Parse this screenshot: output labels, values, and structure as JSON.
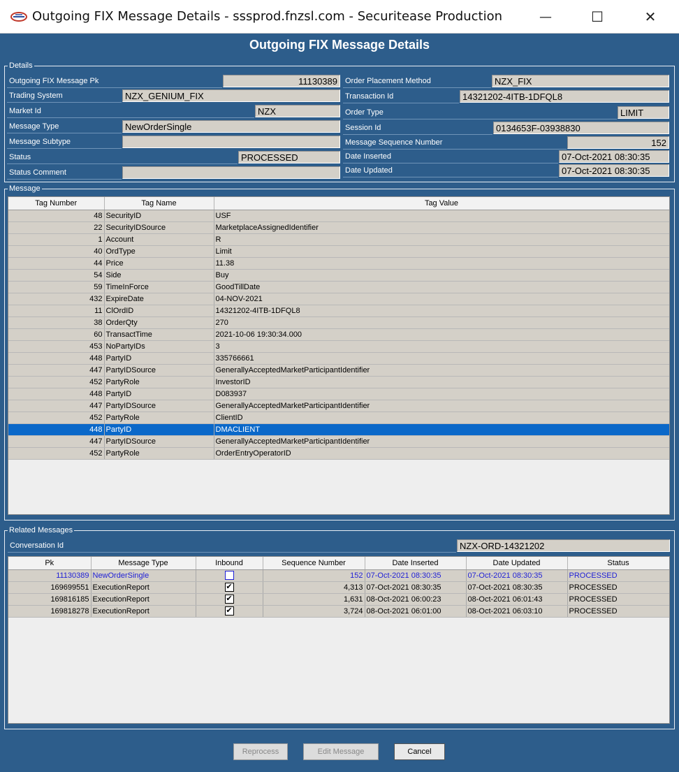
{
  "window": {
    "title": "Outgoing FIX Message Details - sssprod.fnzsl.com - Securitease Production",
    "min_glyph": "—",
    "max_glyph": "☐",
    "close_glyph": "✕"
  },
  "banner": "Outgoing FIX Message Details",
  "details": {
    "legend": "Details",
    "left": [
      {
        "label": "Outgoing FIX Message Pk",
        "value": "11130389"
      },
      {
        "label": "Trading System",
        "value": "NZX_GENIUM_FIX"
      },
      {
        "label": "Market Id",
        "value": "NZX"
      },
      {
        "label": "Message Type",
        "value": "NewOrderSingle"
      },
      {
        "label": "Message Subtype",
        "value": ""
      },
      {
        "label": "Status",
        "value": "PROCESSED"
      },
      {
        "label": "Status Comment",
        "value": ""
      }
    ],
    "right": [
      {
        "label": "Order Placement Method",
        "value": "NZX_FIX"
      },
      {
        "label": "Transaction Id",
        "value": "14321202-4ITB-1DFQL8"
      },
      {
        "label": "Order Type",
        "value": "LIMIT"
      },
      {
        "label": "Session Id",
        "value": "0134653F-03938830"
      },
      {
        "label": "Message Sequence Number",
        "value": "152"
      },
      {
        "label": "Date Inserted",
        "value": "07-Oct-2021 08:30:35"
      },
      {
        "label": "Date Updated",
        "value": "07-Oct-2021 08:30:35"
      }
    ]
  },
  "message": {
    "legend": "Message",
    "columns": [
      "Tag Number",
      "Tag Name",
      "Tag Value"
    ],
    "selected_index": 18,
    "rows": [
      [
        "48",
        "SecurityID",
        "USF"
      ],
      [
        "22",
        "SecurityIDSource",
        "MarketplaceAssignedIdentifier"
      ],
      [
        "1",
        "Account",
        "R"
      ],
      [
        "40",
        "OrdType",
        "Limit"
      ],
      [
        "44",
        "Price",
        "11.38"
      ],
      [
        "54",
        "Side",
        "Buy"
      ],
      [
        "59",
        "TimeInForce",
        "GoodTillDate"
      ],
      [
        "432",
        "ExpireDate",
        "04-NOV-2021"
      ],
      [
        "11",
        "ClOrdID",
        "14321202-4ITB-1DFQL8"
      ],
      [
        "38",
        "OrderQty",
        "270"
      ],
      [
        "60",
        "TransactTime",
        "2021-10-06 19:30:34.000"
      ],
      [
        "453",
        "NoPartyIDs",
        "3"
      ],
      [
        "448",
        "PartyID",
        "335766661"
      ],
      [
        "447",
        "PartyIDSource",
        "GenerallyAcceptedMarketParticipantIdentifier"
      ],
      [
        "452",
        "PartyRole",
        "InvestorID"
      ],
      [
        "448",
        "PartyID",
        "D083937"
      ],
      [
        "447",
        "PartyIDSource",
        "GenerallyAcceptedMarketParticipantIdentifier"
      ],
      [
        "452",
        "PartyRole",
        "ClientID"
      ],
      [
        "448",
        "PartyID",
        "DMACLIENT"
      ],
      [
        "447",
        "PartyIDSource",
        "GenerallyAcceptedMarketParticipantIdentifier"
      ],
      [
        "452",
        "PartyRole",
        "OrderEntryOperatorID"
      ]
    ]
  },
  "related": {
    "legend": "Related Messages",
    "conversation_label": "Conversation Id",
    "conversation_value": "NZX-ORD-14321202",
    "columns": [
      "Pk",
      "Message Type",
      "Inbound",
      "Sequence Number",
      "Date Inserted",
      "Date Updated",
      "Status"
    ],
    "rows": [
      {
        "pk": "11130389",
        "type": "NewOrderSingle",
        "inbound": false,
        "seq": "152",
        "inserted": "07-Oct-2021 08:30:35",
        "updated": "07-Oct-2021 08:30:35",
        "status": "PROCESSED",
        "current": true
      },
      {
        "pk": "169699551",
        "type": "ExecutionReport",
        "inbound": true,
        "seq": "4,313",
        "inserted": "07-Oct-2021 08:30:35",
        "updated": "07-Oct-2021 08:30:35",
        "status": "PROCESSED",
        "current": false
      },
      {
        "pk": "169816185",
        "type": "ExecutionReport",
        "inbound": true,
        "seq": "1,631",
        "inserted": "08-Oct-2021 06:00:23",
        "updated": "08-Oct-2021 06:01:43",
        "status": "PROCESSED",
        "current": false
      },
      {
        "pk": "169818278",
        "type": "ExecutionReport",
        "inbound": true,
        "seq": "3,724",
        "inserted": "08-Oct-2021 06:01:00",
        "updated": "08-Oct-2021 06:03:10",
        "status": "PROCESSED",
        "current": false
      }
    ]
  },
  "buttons": {
    "reprocess": "Reprocess",
    "edit": "Edit Message",
    "cancel": "Cancel"
  },
  "colors": {
    "background": "#2d5d8b",
    "selection": "#0a68c9",
    "current_row_text": "#1f1fd6"
  }
}
